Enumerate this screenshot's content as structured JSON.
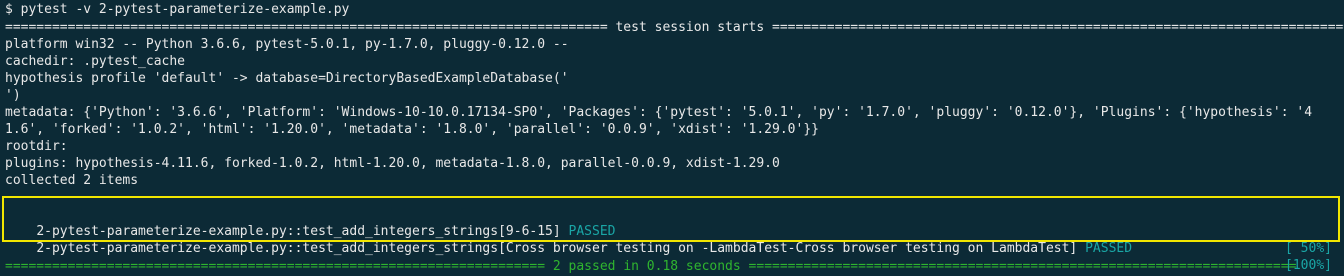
{
  "terminal": {
    "command": "$ pytest -v 2-pytest-parameterize-example.py",
    "session_header": "============================================================================= test session starts ==============================================================================",
    "platform_line": "platform win32 -- Python 3.6.6, pytest-5.0.1, py-1.7.0, pluggy-0.12.0 --",
    "cachedir_line": "cachedir: .pytest_cache",
    "hypothesis_line": "hypothesis profile 'default' -> database=DirectoryBasedExampleDatabase('",
    "hypothesis_close": "')",
    "metadata_line1": "metadata: {'Python': '3.6.6', 'Platform': 'Windows-10-10.0.17134-SP0', 'Packages': {'pytest': '5.0.1', 'py': '1.7.0', 'pluggy': '0.12.0'}, 'Plugins': {'hypothesis': '4",
    "metadata_line2": "1.6', 'forked': '1.0.2', 'html': '1.20.0', 'metadata': '1.8.0', 'parallel': '0.0.9', 'xdist': '1.29.0'}}",
    "rootdir_line": "rootdir:",
    "plugins_line": "plugins: hypothesis-4.11.6, forked-1.0.2, html-1.20.0, metadata-1.8.0, parallel-0.0.9, xdist-1.29.0",
    "collected_line": "collected 2 items",
    "results": [
      {
        "test": "2-pytest-parameterize-example.py::test_add_integers_strings[9-6-15]",
        "status": "PASSED",
        "progress": "[ 50%]"
      },
      {
        "test": "2-pytest-parameterize-example.py::test_add_integers_strings[Cross browser testing on -LambdaTest-Cross browser testing on LambdaTest]",
        "status": "PASSED",
        "progress": "[100%]"
      }
    ],
    "summary_left": "=====================================================================",
    "summary_text": " 2 passed in 0.18 seconds ",
    "summary_right": "======================================================================",
    "colors": {
      "background": "#0c2a36",
      "text": "#e8e8e8",
      "passed": "#1aa6a6",
      "summary": "#2fb52f",
      "highlight_box": "#f2e600"
    }
  }
}
